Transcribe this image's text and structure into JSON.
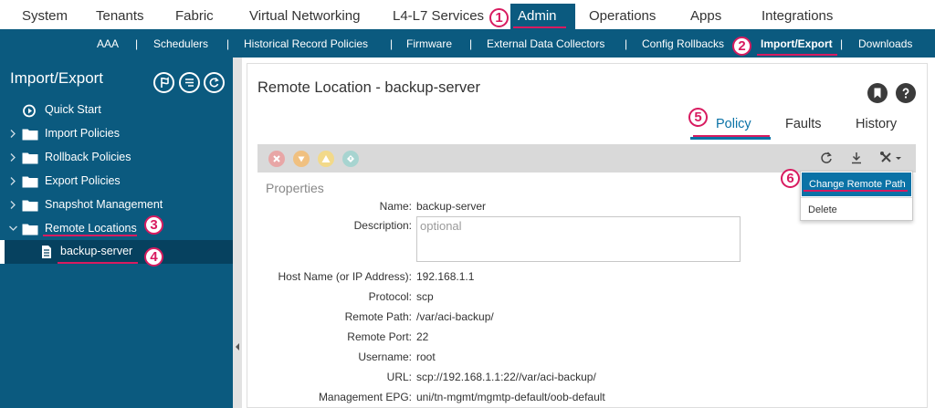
{
  "top_nav": {
    "items": [
      "System",
      "Tenants",
      "Fabric",
      "Virtual Networking",
      "L4-L7 Services",
      "Admin",
      "Operations",
      "Apps",
      "Integrations"
    ],
    "active": "Admin"
  },
  "sub_nav": {
    "items": [
      "AAA",
      "Schedulers",
      "Historical Record Policies",
      "Firmware",
      "External Data Collectors",
      "Config Rollbacks",
      "Import/Export",
      "Downloads"
    ],
    "separator": "|",
    "active": "Import/Export"
  },
  "sidebar": {
    "title": "Import/Export",
    "items": [
      {
        "label": "Quick Start"
      },
      {
        "label": "Import Policies"
      },
      {
        "label": "Rollback Policies"
      },
      {
        "label": "Export Policies"
      },
      {
        "label": "Snapshot Management"
      },
      {
        "label": "Remote Locations"
      },
      {
        "label": "backup-server"
      }
    ]
  },
  "main": {
    "title": "Remote Location - backup-server",
    "tabs": [
      "Policy",
      "Faults",
      "History"
    ],
    "active_tab": "Policy",
    "properties_heading": "Properties",
    "fields": {
      "name": {
        "label": "Name:",
        "value": "backup-server"
      },
      "description": {
        "label": "Description:",
        "placeholder": "optional"
      },
      "host": {
        "label": "Host Name (or IP Address):",
        "value": "192.168.1.1"
      },
      "protocol": {
        "label": "Protocol:",
        "value": "scp"
      },
      "remote_path": {
        "label": "Remote Path:",
        "value": "/var/aci-backup/"
      },
      "remote_port": {
        "label": "Remote Port:",
        "value": "22"
      },
      "username": {
        "label": "Username:",
        "value": "root"
      },
      "url": {
        "label": "URL:",
        "value": "scp://192.168.1.1:22//var/aci-backup/"
      },
      "mgmt_epg": {
        "label": "Management EPG:",
        "value": "uni/tn-mgmt/mgmtp-default/oob-default"
      }
    }
  },
  "dropdown": {
    "items": [
      "Change Remote Path",
      "Delete"
    ]
  },
  "annotations": [
    "1",
    "2",
    "3",
    "4",
    "5",
    "6"
  ],
  "colors": {
    "nav_blue": "#0b5a7f",
    "selected_row": "#06415f",
    "accent_blue": "#0a72a6",
    "annotation_magenta": "#d81b60",
    "fault_critical": "#e8a6a6",
    "fault_major": "#f0c080",
    "fault_minor": "#f2d98a",
    "fault_warning": "#a7d4d0"
  },
  "icons": [
    "refresh-icon",
    "download-icon",
    "tools-icon",
    "bookmark-icon",
    "help-icon"
  ]
}
